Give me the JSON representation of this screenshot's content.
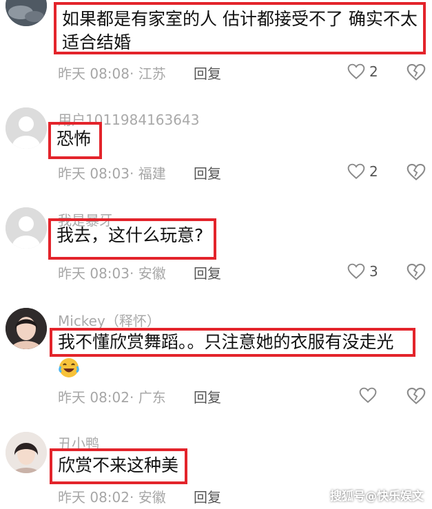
{
  "comments": [
    {
      "text": "如果都是有家室的人 估计都接受不了 确实不太适合结婚",
      "time": "昨天 08:08",
      "location": "· 江苏",
      "reply": "回复",
      "likes": "2"
    },
    {
      "username": "用户1011984163643",
      "text": "恐怖",
      "time": "昨天 08:03",
      "location": "· 福建",
      "reply": "回复",
      "likes": "2"
    },
    {
      "username": "我是暴牙",
      "text": "我去，这什么玩意?",
      "time": "昨天 08:03",
      "location": "· 安徽",
      "reply": "回复",
      "likes": "3"
    },
    {
      "username": "Mickey（释怀）",
      "text": "我不懂欣赏舞蹈。。只注意她的衣服有没走光",
      "time": "昨天 08:02",
      "location": "· 广东",
      "reply": "回复",
      "likes": ""
    },
    {
      "username": "丑小鸭",
      "text": "欣赏不来这种美",
      "time": "昨天 08:02",
      "location": "· 安徽",
      "reply": "回复",
      "likes": ""
    }
  ],
  "watermark": "搜狐号@快乐娱文",
  "colors": {
    "highlight_border": "#e3242b",
    "meta_text": "#a6a6a6"
  },
  "icons": [
    "heart-icon",
    "broken-heart-icon",
    "default-avatar-icon",
    "laughing-crying-emoji-icon"
  ]
}
